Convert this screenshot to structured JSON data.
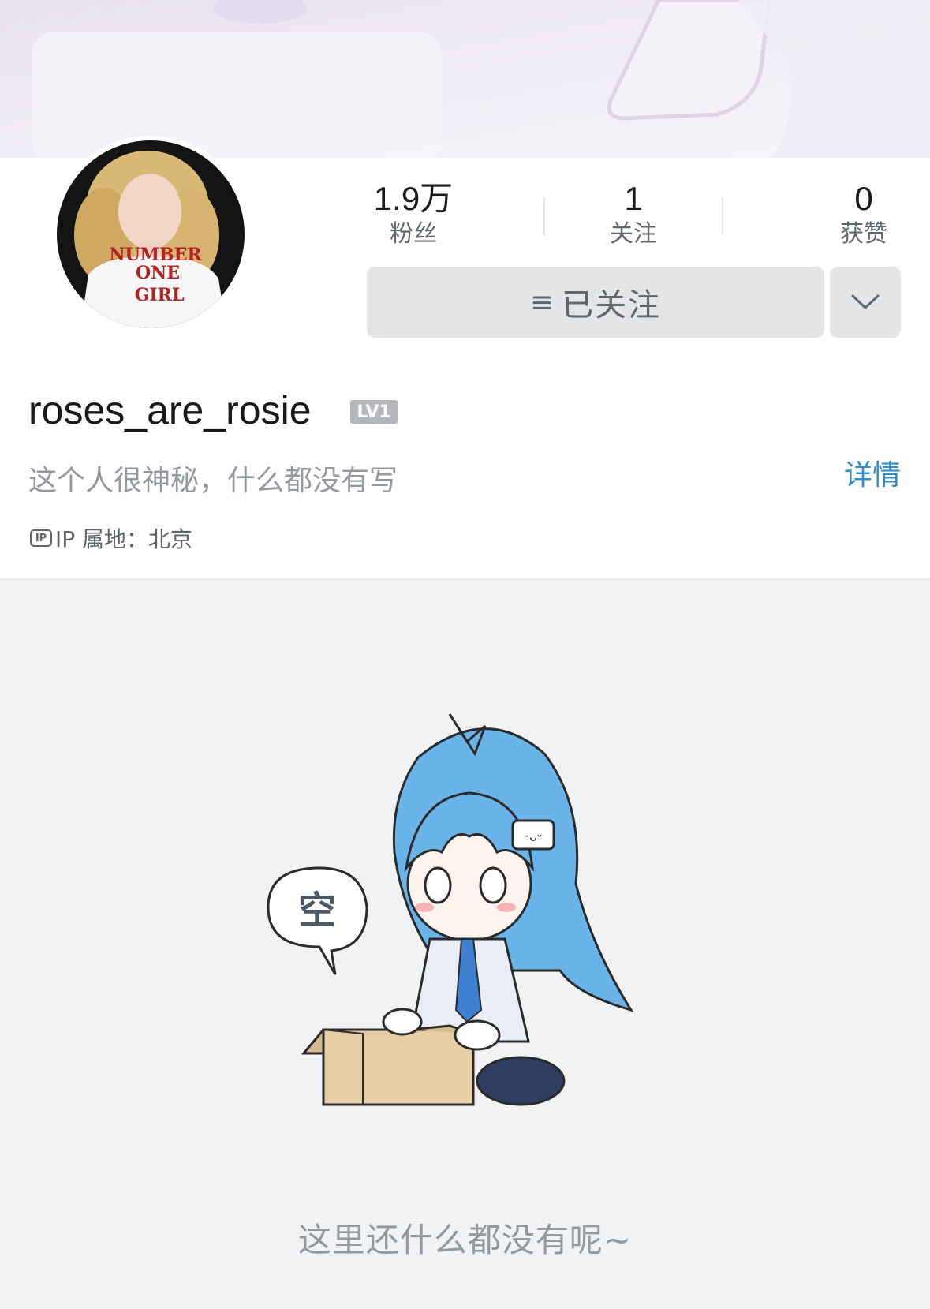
{
  "banner": {
    "image": "profile-banner"
  },
  "avatar": {
    "image": "profile-avatar",
    "shirt_lines": [
      "NUMBER",
      "ONE",
      "GIRL"
    ]
  },
  "stats": [
    {
      "value": "1.9万",
      "label": "粉丝"
    },
    {
      "value": "1",
      "label": "关注"
    },
    {
      "value": "0",
      "label": "获赞"
    }
  ],
  "actions": {
    "follow_icon": "menu-icon",
    "follow_label": "已关注",
    "more_icon": "chevron-down-icon"
  },
  "profile": {
    "username": "roses_are_rosie",
    "level": "LV1",
    "bio": "这个人很神秘，什么都没有写",
    "details_link": "详情",
    "ip_badge": "IP",
    "ip_location": "IP 属地：北京"
  },
  "empty_state": {
    "bubble_text": "空",
    "message": "这里还什么都没有呢~"
  },
  "colors": {
    "accent_link": "#2d8fc9",
    "muted_text": "#9499a0",
    "button_bg": "#e3e5e7"
  }
}
